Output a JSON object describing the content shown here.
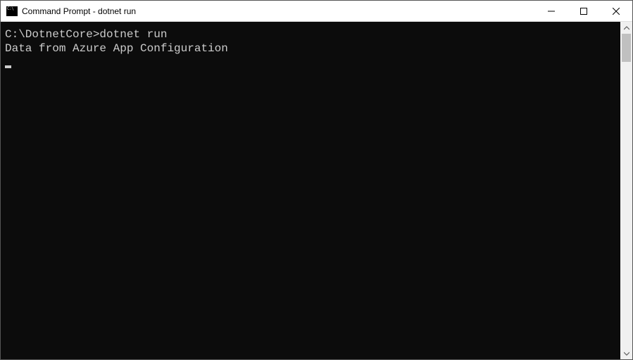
{
  "window": {
    "title": "Command Prompt - dotnet  run"
  },
  "terminal": {
    "prompt": "C:\\DotnetCore>",
    "command": "dotnet run",
    "output": "Data from Azure App Configuration"
  }
}
